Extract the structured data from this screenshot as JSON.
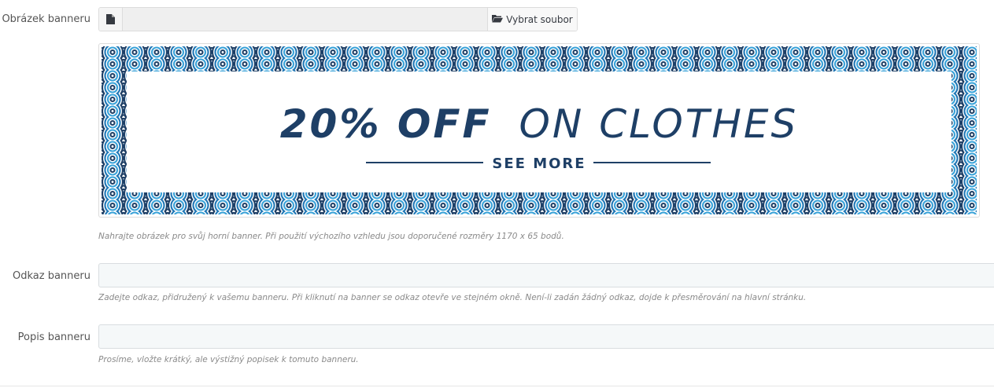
{
  "image_field": {
    "label": "Obrázek banneru",
    "browse_button": "Vybrat soubor",
    "file_icon": "file-icon",
    "folder_icon": "folder-open-icon",
    "help": "Nahrajte obrázek pro svůj horní banner. Při použití výchozího vzhledu jsou doporučené rozměry 1170 x 65 bodů."
  },
  "banner_preview": {
    "headline_bold": "20% OFF",
    "headline_light": "ON CLOTHES",
    "cta": "SEE MORE",
    "colors": {
      "navy": "#1e3f66",
      "blue": "#1f76b5",
      "light_blue": "#3aa3d9",
      "white": "#ffffff"
    }
  },
  "link_field": {
    "label": "Odkaz banneru",
    "value": "",
    "help": "Zadejte odkaz, přidružený k vašemu banneru. Při kliknutí na banner se odkaz otevře ve stejném okně. Není-li zadán žádný odkaz, dojde k přesměrování na hlavní stránku."
  },
  "description_field": {
    "label": "Popis banneru",
    "value": "",
    "help": "Prosíme, vložte krátký, ale výstižný popisek k tomuto banneru."
  }
}
